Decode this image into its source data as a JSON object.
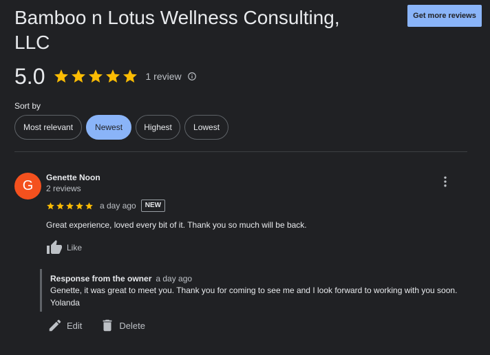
{
  "header": {
    "title": "Bamboo n Lotus Wellness Consulting, LLC",
    "get_more_reviews_label": "Get more reviews"
  },
  "summary": {
    "rating_text": "5.0",
    "rating": 5,
    "review_count_text": "1 review"
  },
  "sort": {
    "label": "Sort by",
    "options": [
      "Most relevant",
      "Newest",
      "Highest",
      "Lowest"
    ],
    "selected": "Newest"
  },
  "review": {
    "avatar_letter": "G",
    "avatar_color": "#f4511e",
    "reviewer_name": "Genette Noon",
    "reviewer_meta": "2 reviews",
    "stars": 5,
    "time": "a day ago",
    "badge": "NEW",
    "text": "Great experience, loved every bit of it. Thank you so much will be back.",
    "like_label": "Like",
    "owner_response": {
      "label": "Response from the owner",
      "time": "a day ago",
      "text": "Genette, it was great to meet you. Thank you for coming to see me and I look forward to working with you soon. Yolanda"
    },
    "actions": {
      "edit_label": "Edit",
      "delete_label": "Delete"
    }
  },
  "colors": {
    "background": "#202124",
    "accent": "#8ab4f8",
    "star": "#fbbc04"
  },
  "icons": [
    "star-icon",
    "info-icon",
    "more-vert-icon",
    "thumb-up-icon",
    "edit-icon",
    "delete-icon"
  ]
}
